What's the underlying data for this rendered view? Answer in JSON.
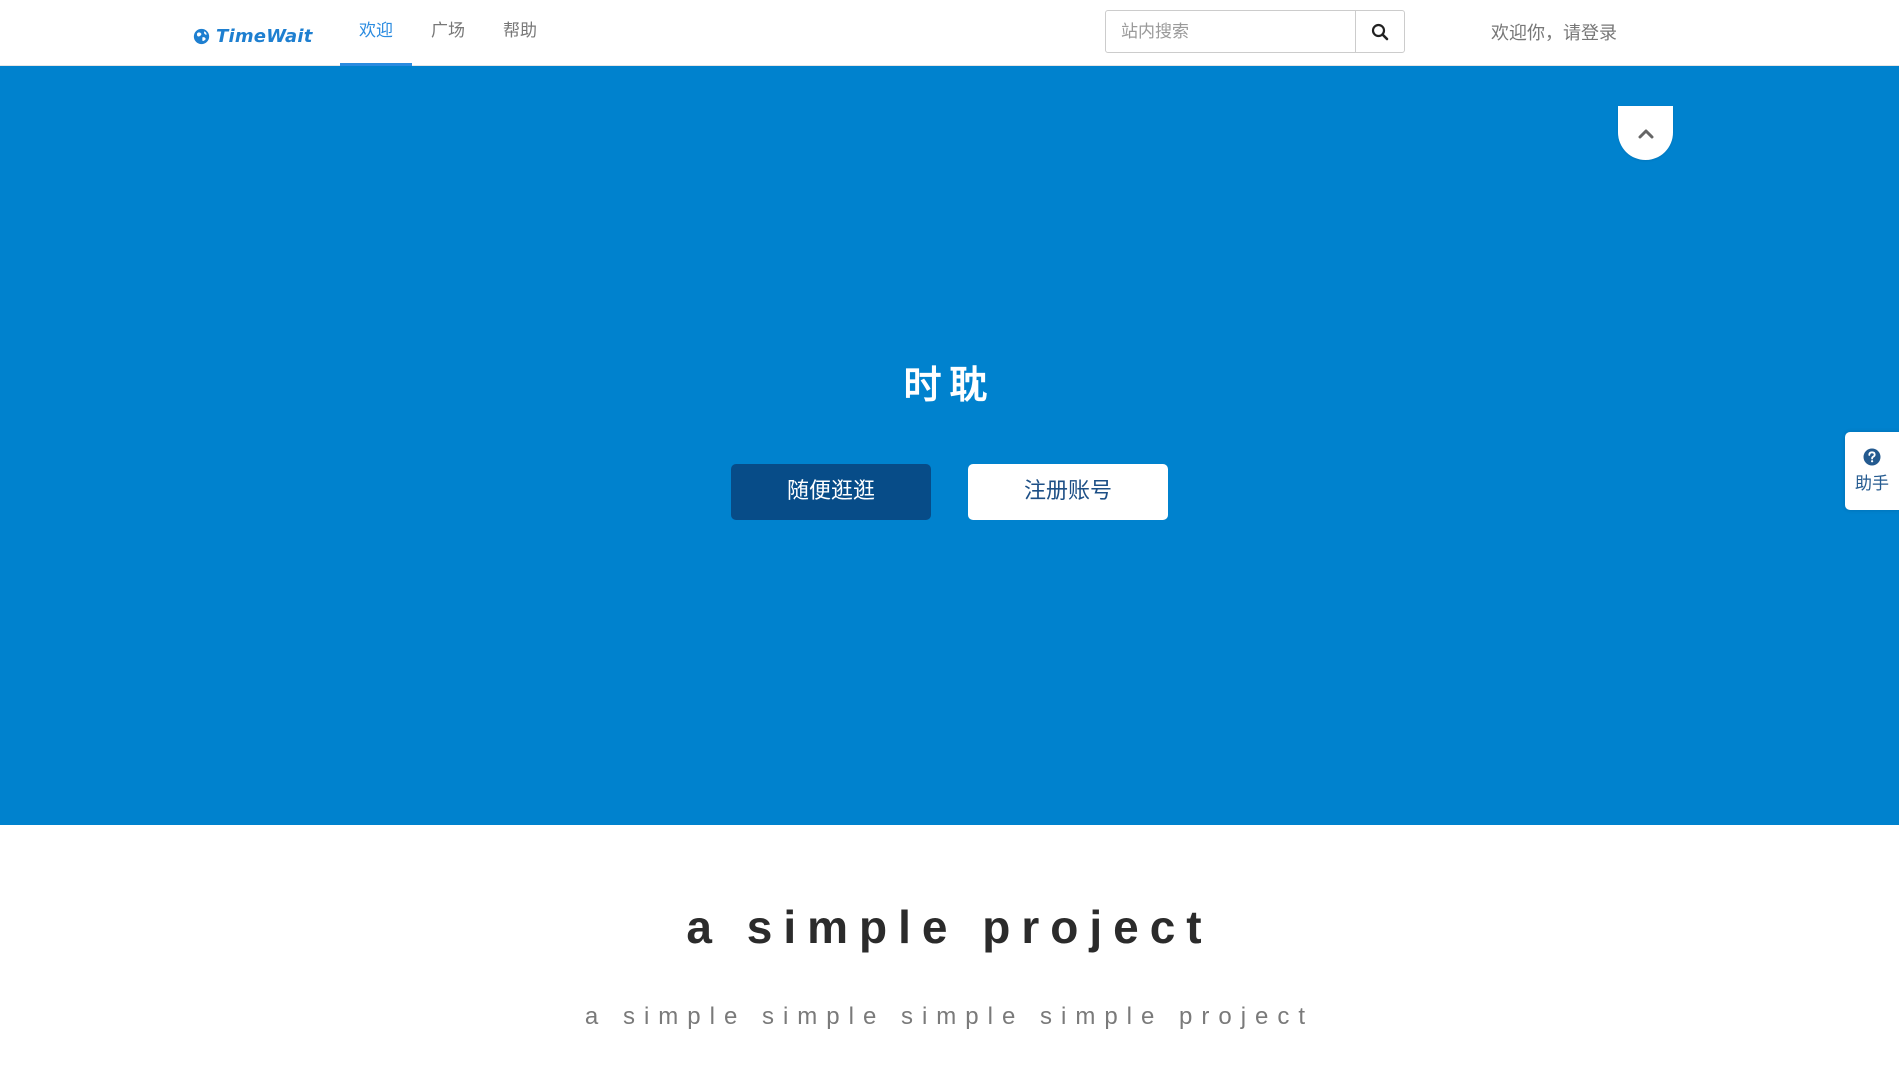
{
  "navbar": {
    "brand": "TimeWait",
    "brand_color": "#1e7fd0",
    "tabs": [
      {
        "label": "欢迎",
        "active": true
      },
      {
        "label": "广场",
        "active": false
      },
      {
        "label": "帮助",
        "active": false
      }
    ],
    "search": {
      "placeholder": "站内搜索",
      "value": "",
      "button_icon": "search-icon"
    },
    "login_text": "欢迎你，请登录"
  },
  "hero": {
    "background": "#0082ce",
    "title": "时耽",
    "primary_button": "随便逛逛",
    "secondary_button": "注册账号",
    "scroll_top_icon": "chevron-up-icon"
  },
  "assistant": {
    "icon": "question-circle-icon",
    "label": "助手"
  },
  "intro": {
    "title": "a simple project",
    "subtitle": "a simple simple simple simple project"
  }
}
